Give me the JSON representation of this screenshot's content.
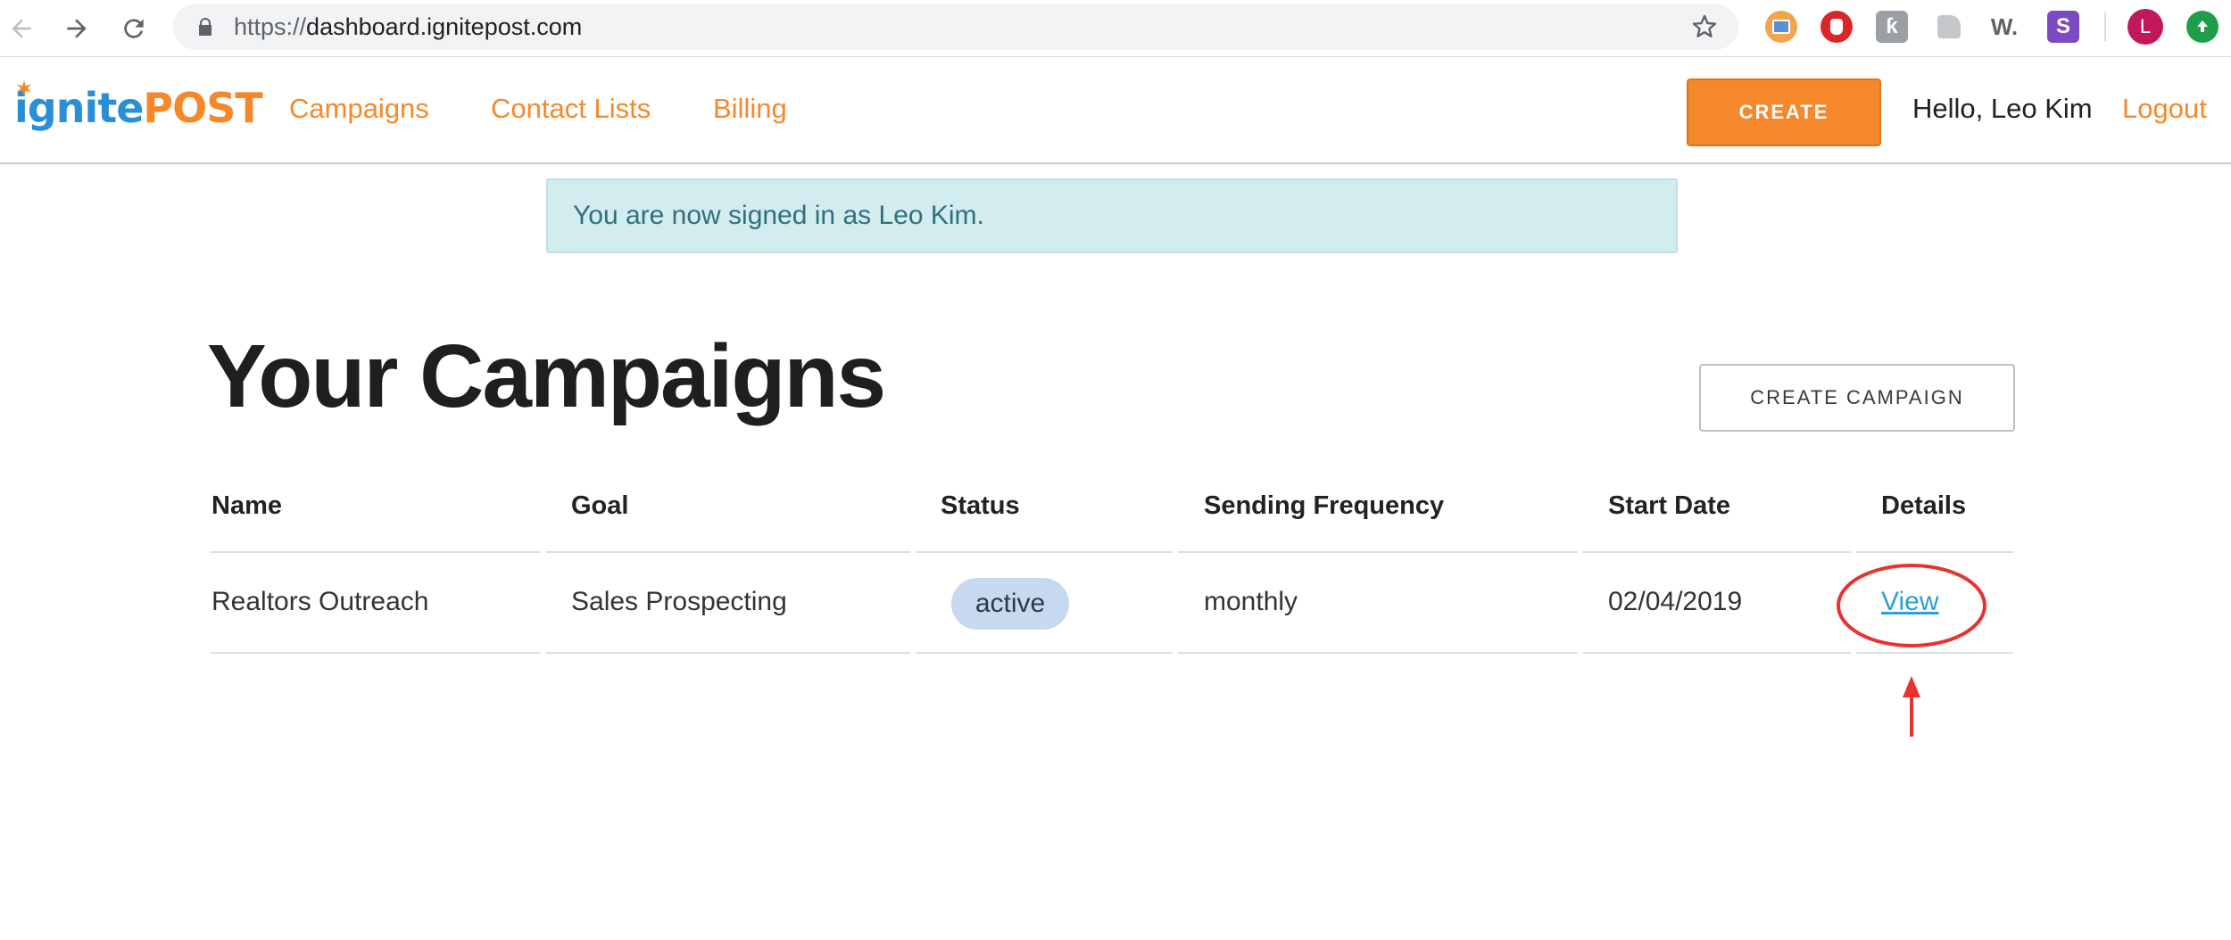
{
  "browser": {
    "url_scheme": "https://",
    "url_host": "dashboard.ignitepost.com",
    "profile_initial": "L",
    "extensions": [
      "image-extension-icon",
      "stop-hand-extension-icon",
      "k-extension-icon",
      "grey-extension-icon",
      "w-extension-icon",
      "s-extension-icon"
    ],
    "w_ext_label": "W.",
    "s_ext_label": "S"
  },
  "header": {
    "logo_part1": "ignite",
    "logo_part2": "POST",
    "nav": [
      {
        "label": "Campaigns"
      },
      {
        "label": "Contact Lists"
      },
      {
        "label": "Billing"
      }
    ],
    "create_label": "CREATE",
    "greeting": "Hello, Leo Kim",
    "logout_label": "Logout"
  },
  "alert": {
    "text": "You are now signed in as Leo Kim."
  },
  "main": {
    "title": "Your Campaigns",
    "create_campaign_label": "CREATE CAMPAIGN",
    "columns": [
      "Name",
      "Goal",
      "Status",
      "Sending Frequency",
      "Start Date",
      "Details"
    ],
    "rows": [
      {
        "name": "Realtors Outreach",
        "goal": "Sales Prospecting",
        "status": "active",
        "frequency": "monthly",
        "start_date": "02/04/2019",
        "details": "View"
      }
    ]
  },
  "colors": {
    "brand_orange": "#f5882a",
    "brand_blue": "#2b8fd6",
    "alert_bg": "#d2ecef",
    "status_pill": "#c6d9ee",
    "annotation_red": "#e8322f"
  }
}
